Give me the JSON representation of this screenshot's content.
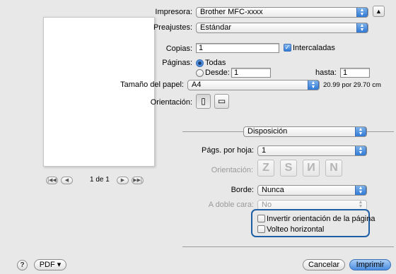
{
  "printer": {
    "label": "Impresora:",
    "value": "Brother MFC-xxxx"
  },
  "presets": {
    "label": "Preajustes:",
    "value": "Estándar"
  },
  "copies": {
    "label": "Copias:",
    "value": "1",
    "collate_label": "Intercaladas",
    "collate_checked": true
  },
  "pages": {
    "label": "Páginas:",
    "all_label": "Todas",
    "from_label": "Desde:",
    "from_value": "1",
    "to_label": "hasta:",
    "to_value": "1"
  },
  "paper_size": {
    "label": "Tamaño del papel:",
    "value": "A4",
    "dimensions": "20.99 por 29.70 cm"
  },
  "orientation": {
    "label": "Orientación:"
  },
  "section": {
    "value": "Disposición"
  },
  "layout": {
    "pages_per_sheet_label": "Págs. por hoja:",
    "pages_per_sheet_value": "1",
    "direction_label": "Orientación:",
    "border_label": "Borde:",
    "border_value": "Nunca",
    "two_sided_label": "A doble cara:",
    "two_sided_value": "No",
    "reverse_label": "Invertir orientación de la página",
    "flip_label": "Volteo horizontal"
  },
  "preview": {
    "page_text": "1 de 1"
  },
  "footer": {
    "help_label": "?",
    "pdf_label": "PDF ▾",
    "cancel_label": "Cancelar",
    "print_label": "Imprimir"
  },
  "colors": {
    "accent": "#2f79d6",
    "highlight": "#1f5fa8",
    "background": "#e8e8e8"
  },
  "icons": [
    "up-down-arrows-icon",
    "collapse-triangle-icon",
    "portrait-icon",
    "landscape-icon",
    "first-page-icon",
    "prev-page-icon",
    "next-page-icon",
    "last-page-icon",
    "help-icon"
  ]
}
